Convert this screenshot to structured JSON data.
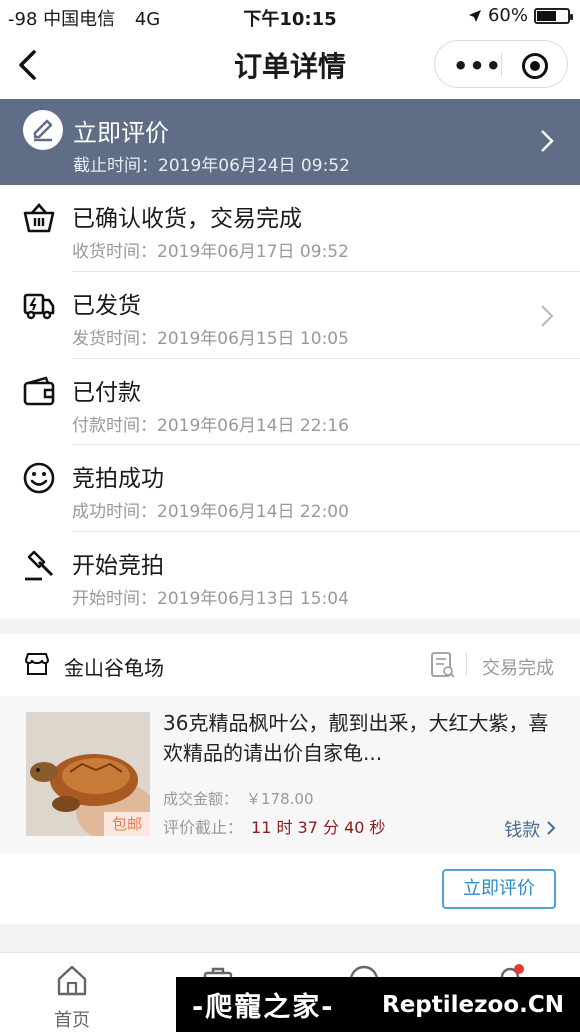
{
  "status_bar": {
    "carrier": "-98 中国电信",
    "network": "4G",
    "time": "下午10:15",
    "battery": "60%",
    "battery_level": 0.6
  },
  "nav": {
    "title": "订单详情",
    "more_icon": "more-dots-icon",
    "close_icon": "target-icon"
  },
  "banner": {
    "title": "立即评价",
    "subtitle": "截止时间：2019年06月24日 09:52",
    "bg_color": "#5f6e86"
  },
  "timeline": [
    {
      "icon": "basket-icon",
      "title": "已确认收货，交易完成",
      "subtitle": "收货时间：2019年06月17日 09:52",
      "chevron": false
    },
    {
      "icon": "truck-icon",
      "title": "已发货",
      "subtitle": "发货时间：2019年06月15日 10:05",
      "chevron": true
    },
    {
      "icon": "wallet-icon",
      "title": "已付款",
      "subtitle": "付款时间：2019年06月14日 22:16",
      "chevron": false
    },
    {
      "icon": "smile-icon",
      "title": "竞拍成功",
      "subtitle": "成功时间：2019年06月14日 22:00",
      "chevron": false
    },
    {
      "icon": "gavel-icon",
      "title": "开始竞拍",
      "subtitle": "开始时间：2019年06月13日 15:04",
      "chevron": false
    }
  ],
  "shop": {
    "name": "金山谷龟场",
    "status": "交易完成"
  },
  "product": {
    "name": "36克精品枫叶公，靓到出釆，大红大紫，喜欢精品的请出价自家龟...",
    "tag": "包邮",
    "amount_label": "成交金额：",
    "amount": "￥178.00",
    "deadline_label": "评价截止：",
    "deadline": "11 时 37 分 40 秒",
    "money_link": "钱款"
  },
  "actions": {
    "rate_button": "立即评价"
  },
  "tabbar": {
    "home": "首页"
  },
  "watermark": {
    "cn": "-爬寵之家-",
    "en": "Reptilezoo.CN"
  },
  "colors": {
    "accent": "#2b8bcb",
    "deadline": "#8b1a1a",
    "tag": "#f07a4a"
  }
}
